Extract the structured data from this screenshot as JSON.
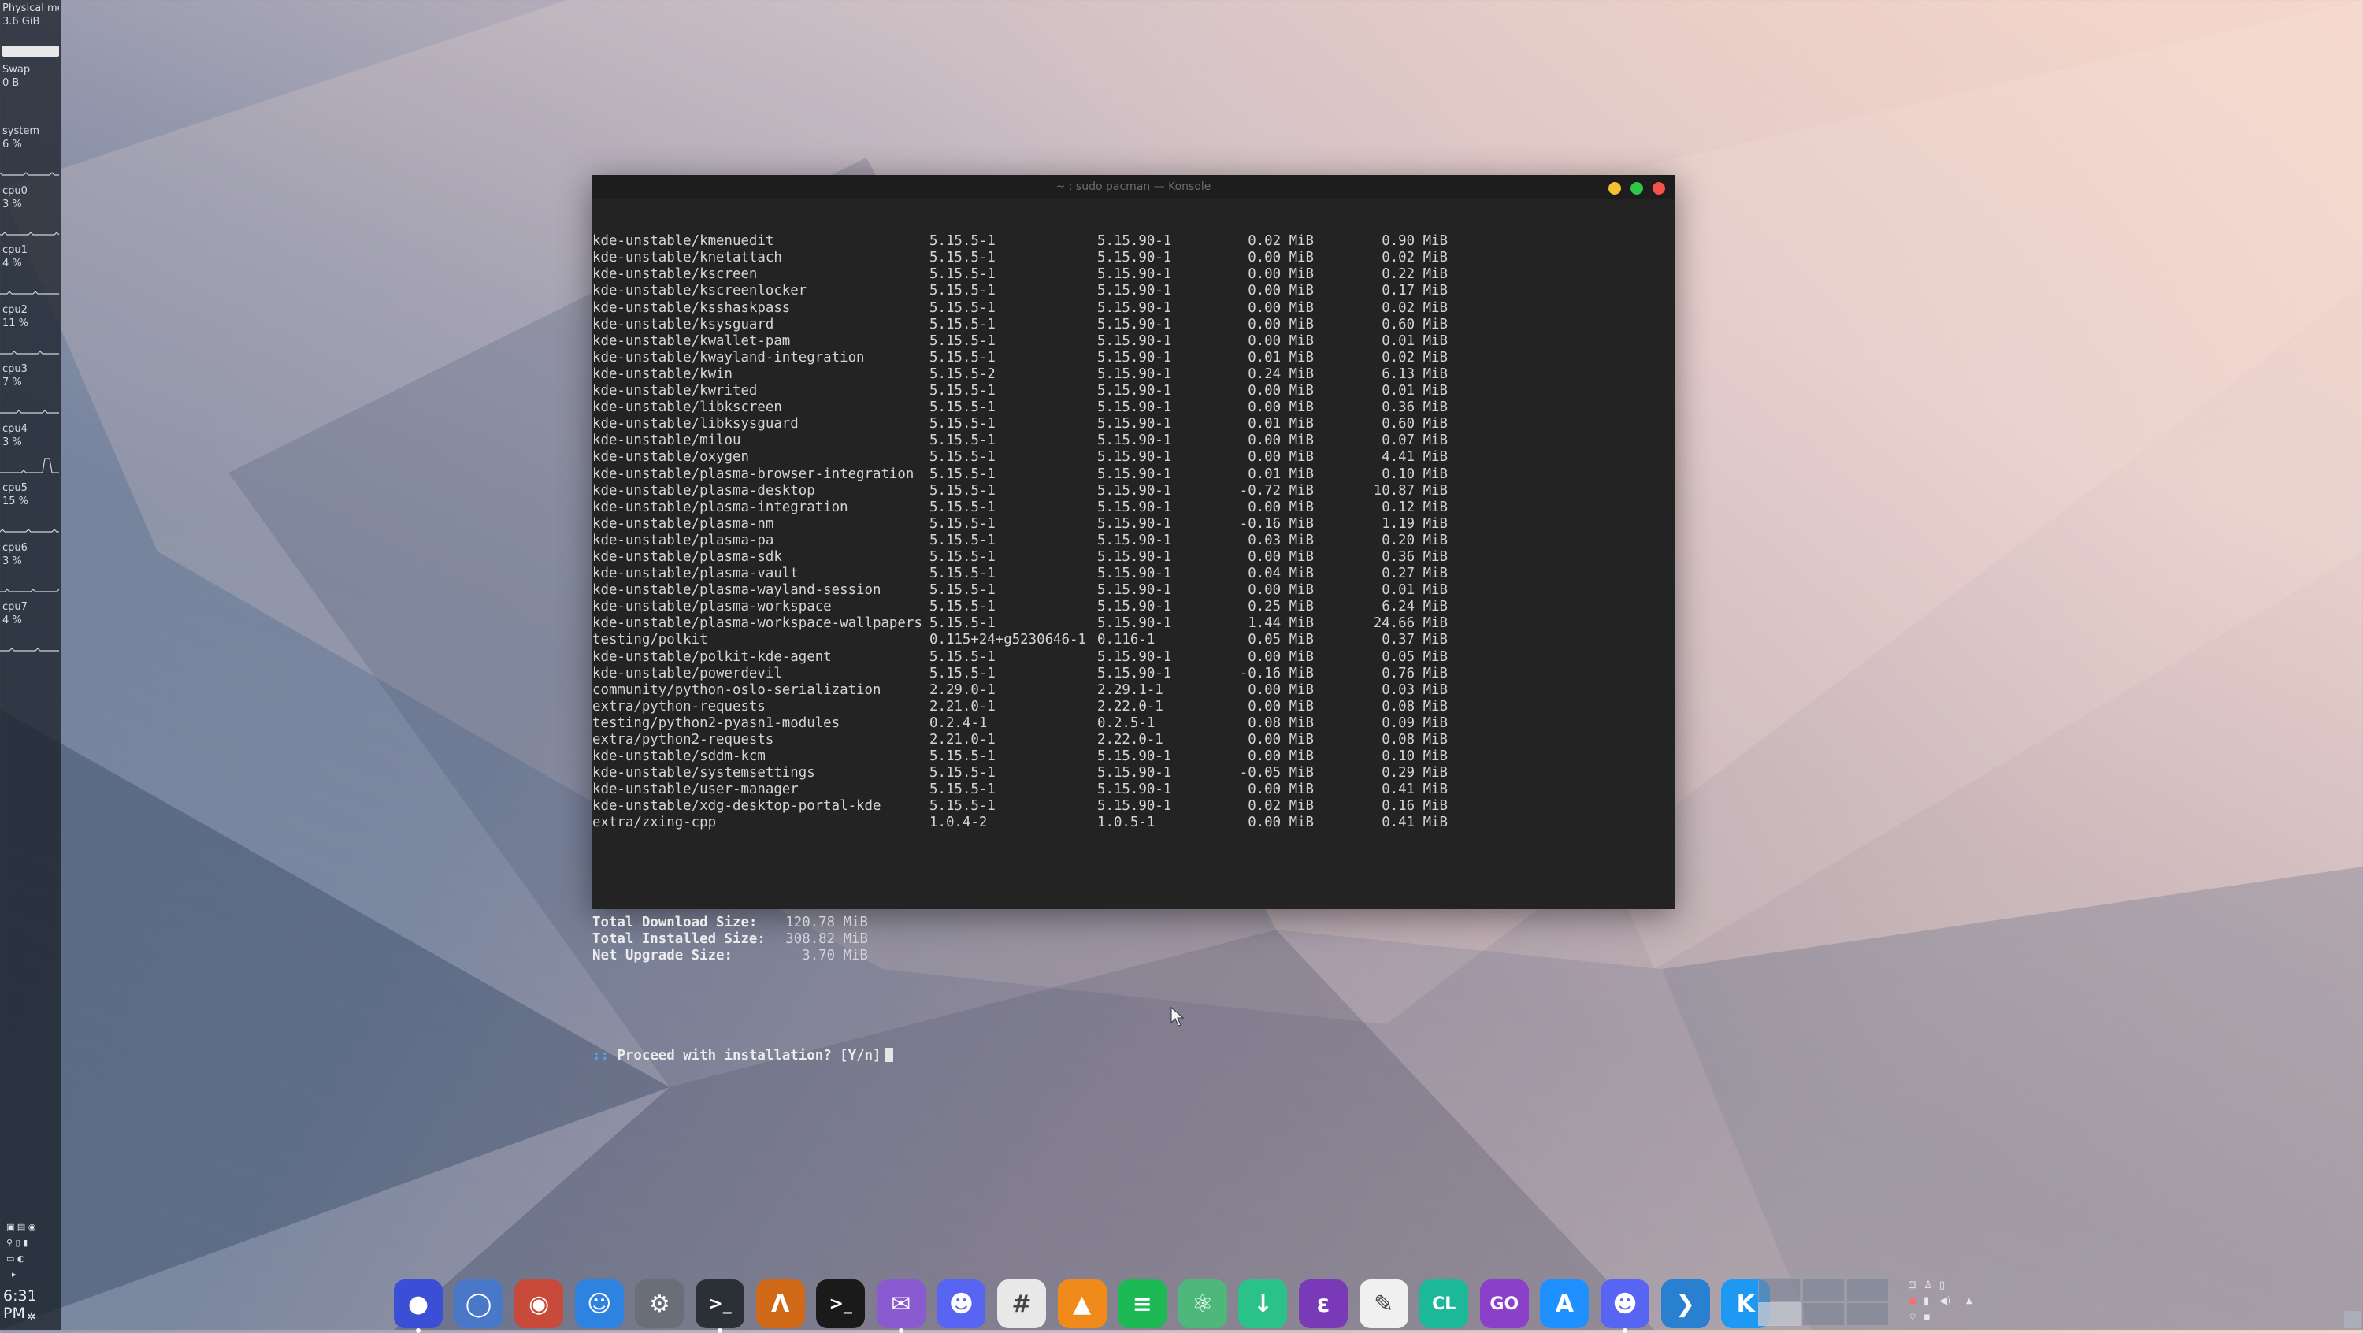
{
  "system_monitor": {
    "memory_label": "Physical mem",
    "memory_value": "3.6 GiB",
    "swap_label": "Swap",
    "swap_value": "0 B",
    "cpus": [
      {
        "label": "system",
        "value": "6 %"
      },
      {
        "label": "cpu0",
        "value": "3 %"
      },
      {
        "label": "cpu1",
        "value": "4 %"
      },
      {
        "label": "cpu2",
        "value": "11 %"
      },
      {
        "label": "cpu3",
        "value": "7 %"
      },
      {
        "label": "cpu4",
        "value": "3 %"
      },
      {
        "label": "cpu5",
        "value": "15 %"
      },
      {
        "label": "cpu6",
        "value": "3 %"
      },
      {
        "label": "cpu7",
        "value": "4 %"
      }
    ]
  },
  "clock": "6:31 PM",
  "konsole": {
    "title": "~ : sudo pacman — Konsole",
    "packages": [
      [
        "kde-unstable/kmenuedit",
        "5.15.5-1",
        "5.15.90-1",
        "0.02 MiB",
        "0.90 MiB"
      ],
      [
        "kde-unstable/knetattach",
        "5.15.5-1",
        "5.15.90-1",
        "0.00 MiB",
        "0.02 MiB"
      ],
      [
        "kde-unstable/kscreen",
        "5.15.5-1",
        "5.15.90-1",
        "0.00 MiB",
        "0.22 MiB"
      ],
      [
        "kde-unstable/kscreenlocker",
        "5.15.5-1",
        "5.15.90-1",
        "0.00 MiB",
        "0.17 MiB"
      ],
      [
        "kde-unstable/ksshaskpass",
        "5.15.5-1",
        "5.15.90-1",
        "0.00 MiB",
        "0.02 MiB"
      ],
      [
        "kde-unstable/ksysguard",
        "5.15.5-1",
        "5.15.90-1",
        "0.00 MiB",
        "0.60 MiB"
      ],
      [
        "kde-unstable/kwallet-pam",
        "5.15.5-1",
        "5.15.90-1",
        "0.00 MiB",
        "0.01 MiB"
      ],
      [
        "kde-unstable/kwayland-integration",
        "5.15.5-1",
        "5.15.90-1",
        "0.01 MiB",
        "0.02 MiB"
      ],
      [
        "kde-unstable/kwin",
        "5.15.5-2",
        "5.15.90-1",
        "0.24 MiB",
        "6.13 MiB"
      ],
      [
        "kde-unstable/kwrited",
        "5.15.5-1",
        "5.15.90-1",
        "0.00 MiB",
        "0.01 MiB"
      ],
      [
        "kde-unstable/libkscreen",
        "5.15.5-1",
        "5.15.90-1",
        "0.00 MiB",
        "0.36 MiB"
      ],
      [
        "kde-unstable/libksysguard",
        "5.15.5-1",
        "5.15.90-1",
        "0.01 MiB",
        "0.60 MiB"
      ],
      [
        "kde-unstable/milou",
        "5.15.5-1",
        "5.15.90-1",
        "0.00 MiB",
        "0.07 MiB"
      ],
      [
        "kde-unstable/oxygen",
        "5.15.5-1",
        "5.15.90-1",
        "0.00 MiB",
        "4.41 MiB"
      ],
      [
        "kde-unstable/plasma-browser-integration",
        "5.15.5-1",
        "5.15.90-1",
        "0.01 MiB",
        "0.10 MiB"
      ],
      [
        "kde-unstable/plasma-desktop",
        "5.15.5-1",
        "5.15.90-1",
        "-0.72 MiB",
        "10.87 MiB"
      ],
      [
        "kde-unstable/plasma-integration",
        "5.15.5-1",
        "5.15.90-1",
        "0.00 MiB",
        "0.12 MiB"
      ],
      [
        "kde-unstable/plasma-nm",
        "5.15.5-1",
        "5.15.90-1",
        "-0.16 MiB",
        "1.19 MiB"
      ],
      [
        "kde-unstable/plasma-pa",
        "5.15.5-1",
        "5.15.90-1",
        "0.03 MiB",
        "0.20 MiB"
      ],
      [
        "kde-unstable/plasma-sdk",
        "5.15.5-1",
        "5.15.90-1",
        "0.00 MiB",
        "0.36 MiB"
      ],
      [
        "kde-unstable/plasma-vault",
        "5.15.5-1",
        "5.15.90-1",
        "0.04 MiB",
        "0.27 MiB"
      ],
      [
        "kde-unstable/plasma-wayland-session",
        "5.15.5-1",
        "5.15.90-1",
        "0.00 MiB",
        "0.01 MiB"
      ],
      [
        "kde-unstable/plasma-workspace",
        "5.15.5-1",
        "5.15.90-1",
        "0.25 MiB",
        "6.24 MiB"
      ],
      [
        "kde-unstable/plasma-workspace-wallpapers",
        "5.15.5-1",
        "5.15.90-1",
        "1.44 MiB",
        "24.66 MiB"
      ],
      [
        "testing/polkit",
        "0.115+24+g5230646-1",
        "0.116-1",
        "0.05 MiB",
        "0.37 MiB"
      ],
      [
        "kde-unstable/polkit-kde-agent",
        "5.15.5-1",
        "5.15.90-1",
        "0.00 MiB",
        "0.05 MiB"
      ],
      [
        "kde-unstable/powerdevil",
        "5.15.5-1",
        "5.15.90-1",
        "-0.16 MiB",
        "0.76 MiB"
      ],
      [
        "community/python-oslo-serialization",
        "2.29.0-1",
        "2.29.1-1",
        "0.00 MiB",
        "0.03 MiB"
      ],
      [
        "extra/python-requests",
        "2.21.0-1",
        "2.22.0-1",
        "0.00 MiB",
        "0.08 MiB"
      ],
      [
        "testing/python2-pyasn1-modules",
        "0.2.4-1",
        "0.2.5-1",
        "0.08 MiB",
        "0.09 MiB"
      ],
      [
        "extra/python2-requests",
        "2.21.0-1",
        "2.22.0-1",
        "0.00 MiB",
        "0.08 MiB"
      ],
      [
        "kde-unstable/sddm-kcm",
        "5.15.5-1",
        "5.15.90-1",
        "0.00 MiB",
        "0.10 MiB"
      ],
      [
        "kde-unstable/systemsettings",
        "5.15.5-1",
        "5.15.90-1",
        "-0.05 MiB",
        "0.29 MiB"
      ],
      [
        "kde-unstable/user-manager",
        "5.15.5-1",
        "5.15.90-1",
        "0.00 MiB",
        "0.41 MiB"
      ],
      [
        "kde-unstable/xdg-desktop-portal-kde",
        "5.15.5-1",
        "5.15.90-1",
        "0.02 MiB",
        "0.16 MiB"
      ],
      [
        "extra/zxing-cpp",
        "1.0.4-2",
        "1.0.5-1",
        "0.00 MiB",
        "0.41 MiB"
      ]
    ],
    "summary": [
      {
        "label": "Total Download Size:",
        "value": "120.78 MiB"
      },
      {
        "label": "Total Installed Size:",
        "value": "308.82 MiB"
      },
      {
        "label": "Net Upgrade Size:",
        "value": "3.70 MiB"
      }
    ],
    "prompt_marker": "::",
    "prompt": "Proceed with installation? [Y/n]"
  },
  "dock": [
    {
      "name": "firefox-nightly-icon",
      "color": "#3a4fd6",
      "glyph": "●",
      "running": true
    },
    {
      "name": "chromium-icon",
      "color": "#4a78c8",
      "glyph": "◯",
      "running": false
    },
    {
      "name": "chrome-dev-icon",
      "color": "#c84a3a",
      "glyph": "◉",
      "running": false
    },
    {
      "name": "dolphin-finder-icon",
      "color": "#2f83e0",
      "glyph": "☺",
      "running": false
    },
    {
      "name": "system-settings-icon",
      "color": "#6a6e76",
      "glyph": "⚙",
      "running": false
    },
    {
      "name": "konsole-icon",
      "color": "#2b2f36",
      "glyph": ">_",
      "running": true
    },
    {
      "name": "kile-icon",
      "color": "#d06a18",
      "glyph": "Λ",
      "running": false
    },
    {
      "name": "terminal-icon",
      "color": "#1a1a1a",
      "glyph": ">_",
      "running": false
    },
    {
      "name": "messenger-icon",
      "color": "#8a5ad0",
      "glyph": "✉",
      "running": true
    },
    {
      "name": "discord-icon",
      "color": "#5865f2",
      "glyph": "☻",
      "running": false
    },
    {
      "name": "slack-icon",
      "color": "#e8e8e8",
      "glyph": "#",
      "running": false
    },
    {
      "name": "vlc-icon",
      "color": "#f08a1a",
      "glyph": "▲",
      "running": false
    },
    {
      "name": "spotify-icon",
      "color": "#1db954",
      "glyph": "≡",
      "running": false
    },
    {
      "name": "atom-icon",
      "color": "#4db87a",
      "glyph": "⚛",
      "running": false
    },
    {
      "name": "download-manager-icon",
      "color": "#2bc28a",
      "glyph": "↓",
      "running": false
    },
    {
      "name": "emacs-icon",
      "color": "#7a3ab8",
      "glyph": "ε",
      "running": false
    },
    {
      "name": "text-editor-icon",
      "color": "#f0f0f0",
      "glyph": "✎",
      "running": false
    },
    {
      "name": "clion-icon",
      "color": "#1cb89a",
      "glyph": "CL",
      "running": false
    },
    {
      "name": "goland-icon",
      "color": "#8a40c8",
      "glyph": "GO",
      "running": false
    },
    {
      "name": "app-store-icon",
      "color": "#1e90ff",
      "glyph": "A",
      "running": false
    },
    {
      "name": "discord-2-icon",
      "color": "#5865f2",
      "glyph": "☻",
      "running": true
    },
    {
      "name": "vscode-icon",
      "color": "#2a80d0",
      "glyph": "❯",
      "running": false
    },
    {
      "name": "kde-icon",
      "color": "#1d99f3",
      "glyph": "K",
      "running": false
    }
  ]
}
